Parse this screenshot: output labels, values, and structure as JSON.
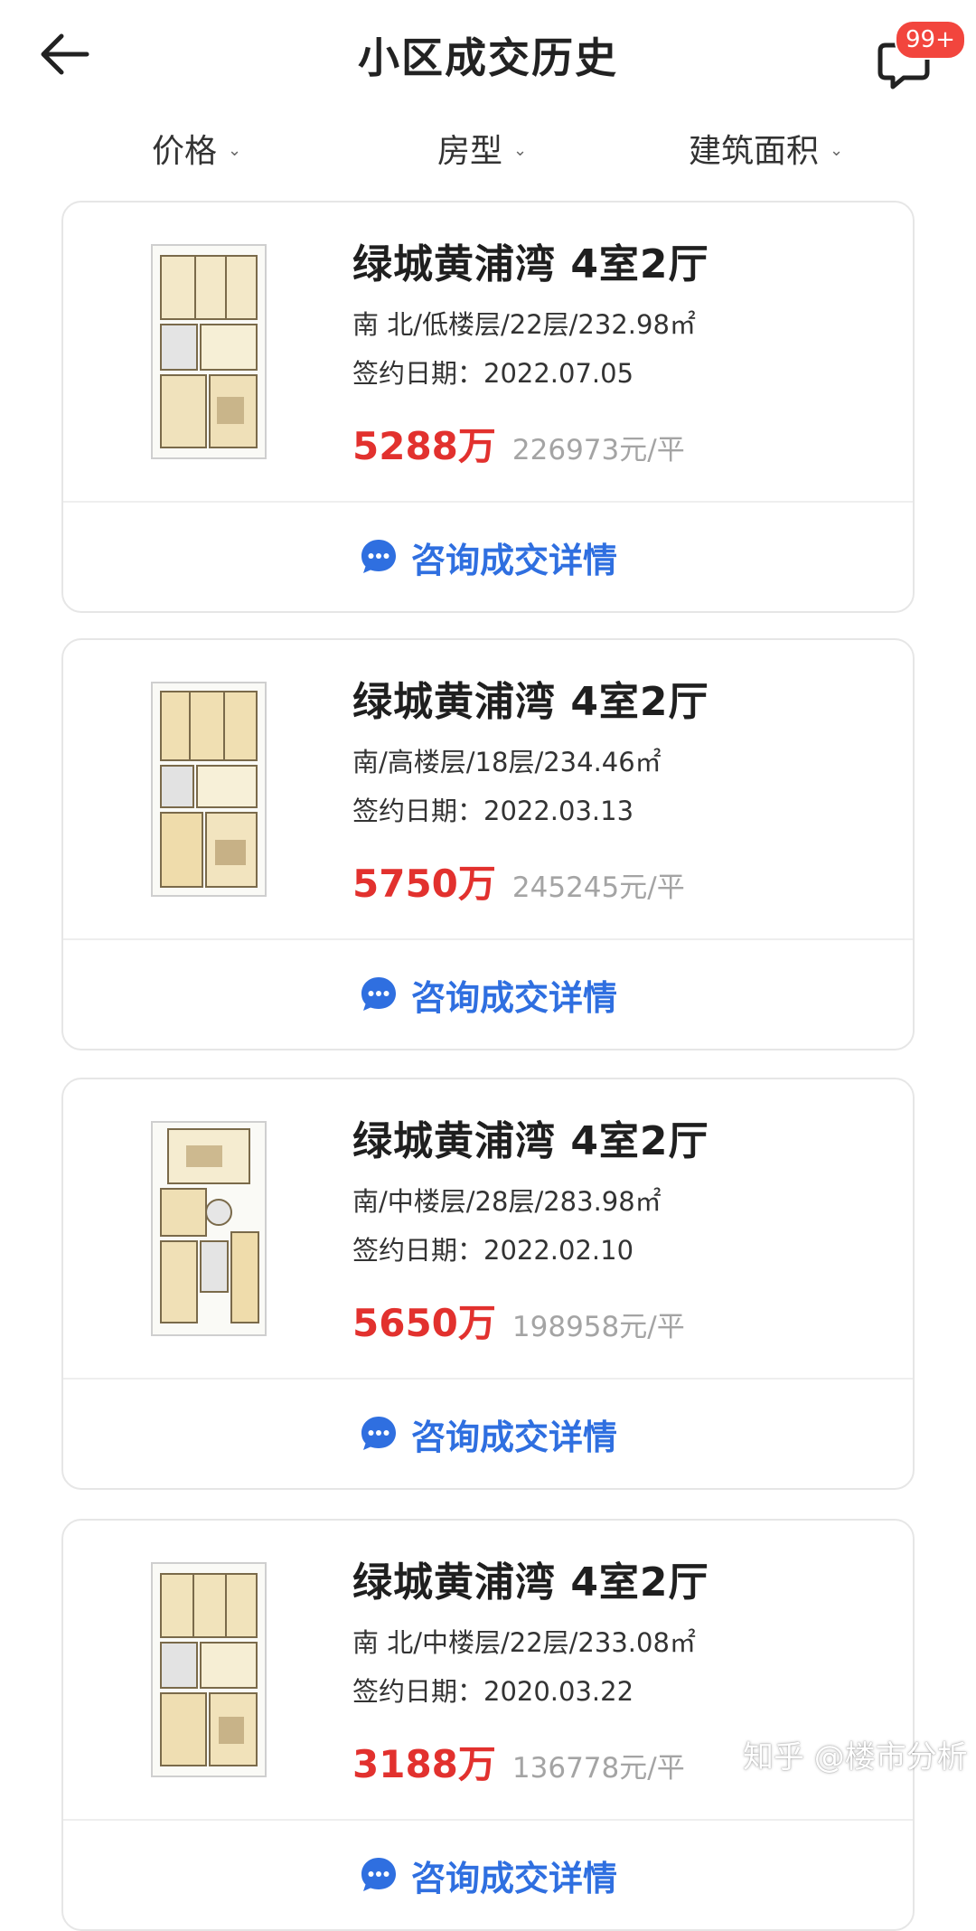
{
  "header": {
    "title": "小区成交历史",
    "back_icon": "arrow-left-icon",
    "message_icon": "chat-bubble-icon",
    "badge": "99+"
  },
  "filters": [
    {
      "label": "价格",
      "icon": "chevron-down-icon"
    },
    {
      "label": "房型",
      "icon": "chevron-down-icon"
    },
    {
      "label": "建筑面积",
      "icon": "chevron-down-icon"
    }
  ],
  "colors": {
    "price": "#e2312e",
    "accent": "#2f6fe0",
    "badge": "#f2453d"
  },
  "listings": [
    {
      "name": "绿城黄浦湾 4室2厅",
      "meta": "南 北/低楼层/22层/232.98㎡",
      "date": "签约日期：2022.07.05",
      "price": "5288万",
      "unit_price": "226973元/平",
      "consult": "咨询成交详情"
    },
    {
      "name": "绿城黄浦湾 4室2厅",
      "meta": "南/高楼层/18层/234.46㎡",
      "date": "签约日期：2022.03.13",
      "price": "5750万",
      "unit_price": "245245元/平",
      "consult": "咨询成交详情"
    },
    {
      "name": "绿城黄浦湾 4室2厅",
      "meta": "南/中楼层/28层/283.98㎡",
      "date": "签约日期：2022.02.10",
      "price": "5650万",
      "unit_price": "198958元/平",
      "consult": "咨询成交详情"
    },
    {
      "name": "绿城黄浦湾 4室2厅",
      "meta": "南 北/中楼层/22层/233.08㎡",
      "date": "签约日期：2020.03.22",
      "price": "3188万",
      "unit_price": "136778元/平",
      "consult": "咨询成交详情"
    }
  ],
  "watermark": "知乎 @楼市分析"
}
